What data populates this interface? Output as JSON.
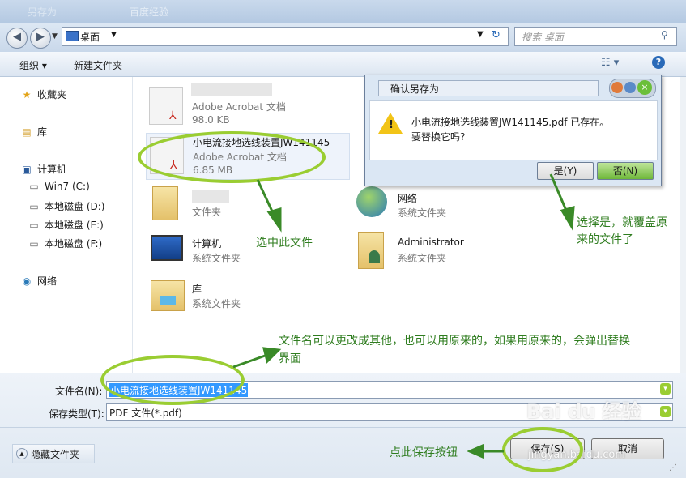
{
  "window": {
    "title": "另存为",
    "faded_title": "百度经验"
  },
  "address": {
    "location": "桌面",
    "search_placeholder": "搜索 桌面"
  },
  "toolbar": {
    "organize": "组织 ▾",
    "new_folder": "新建文件夹"
  },
  "nav": {
    "favorites": "收藏夹",
    "libraries": "库",
    "computer": "计算机",
    "drives": [
      "Win7 (C:)",
      "本地磁盘 (D:)",
      "本地磁盘 (E:)",
      "本地磁盘 (F:)"
    ],
    "network": "网络"
  },
  "files": [
    {
      "name": "",
      "type": "Adobe Acrobat 文档",
      "size": "98.0 KB"
    },
    {
      "name": "小电流接地选线装置JW141145",
      "type": "Adobe Acrobat 文档",
      "size": "6.85 MB"
    },
    {
      "name": "",
      "type": "文件夹",
      "size": ""
    },
    {
      "name": "计算机",
      "type": "系统文件夹",
      "size": ""
    },
    {
      "name": "库",
      "type": "系统文件夹",
      "size": ""
    },
    {
      "name": "网络",
      "type": "系统文件夹",
      "size": ""
    },
    {
      "name": "Administrator",
      "type": "系统文件夹",
      "size": ""
    }
  ],
  "dialog": {
    "title": "确认另存为",
    "message_line1": "小电流接地选线装置JW141145.pdf 已存在。",
    "message_line2": "要替换它吗?",
    "yes": "是(Y)",
    "no": "否(N)"
  },
  "bottom": {
    "filename_label": "文件名(N):",
    "filename_value": "小电流接地选线装置JW141145",
    "filetype_label": "保存类型(T):",
    "filetype_value": "PDF 文件(*.pdf)",
    "hide_folders": "隐藏文件夹",
    "save": "保存(S)",
    "cancel": "取消"
  },
  "annotations": {
    "select_file": "选中此文件",
    "choose_yes_line1": "选择是，就覆盖原",
    "choose_yes_line2": "来的文件了",
    "rename_line1": "文件名可以更改成其他，也可以用原来的，如果用原来的，会弹出替换",
    "rename_line2": "界面",
    "click_save": "点此保存按钮"
  },
  "watermark": {
    "text": "Bai du 经验",
    "url": "jingyan.baidu.com"
  },
  "colors": {
    "annotation": "#2f7d1f",
    "ellipse": "#9acd32",
    "selection": "#3399ff"
  }
}
